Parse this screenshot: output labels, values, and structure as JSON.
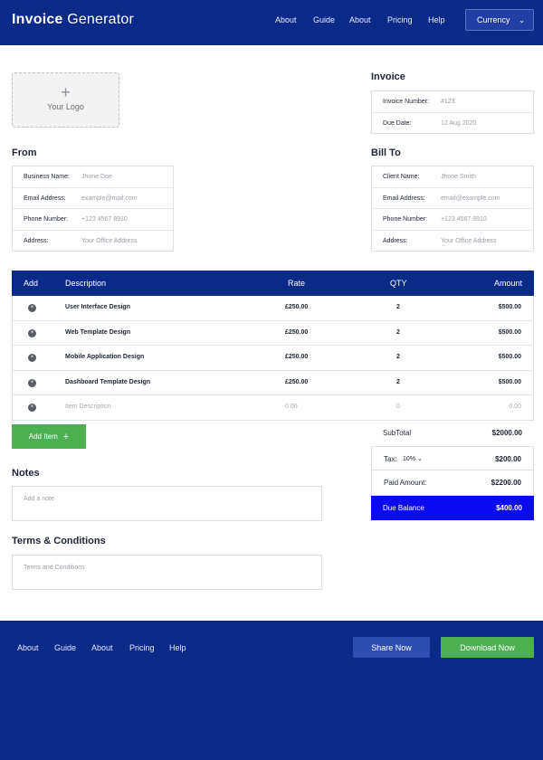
{
  "header": {
    "brand_bold": "Invoice",
    "brand_rest": " Generator",
    "nav": [
      "About",
      "Guide",
      "About",
      "Pricing",
      "Help"
    ],
    "currency_label": "Currency"
  },
  "logo": {
    "label": "Your Logo"
  },
  "invoice": {
    "title": "Invoice",
    "number_label": "Invoice Number:",
    "number_value": "#123",
    "due_label": "Due Date:",
    "due_value": "12 Aug 2020"
  },
  "from": {
    "title": "From",
    "fields": [
      {
        "label": "Business Name:",
        "placeholder": "Jhone Doe"
      },
      {
        "label": "Email Address:",
        "placeholder": "example@mail.com"
      },
      {
        "label": "Phone Number:",
        "placeholder": "+123 4567 8910"
      },
      {
        "label": "Address:",
        "placeholder": "Your Office Address"
      }
    ]
  },
  "bill_to": {
    "title": "Bill To",
    "fields": [
      {
        "label": "Client Name:",
        "placeholder": "Jhone Smith"
      },
      {
        "label": "Email Address:",
        "placeholder": "email@example.com"
      },
      {
        "label": "Phone Number:",
        "placeholder": "+123 4567 8910"
      },
      {
        "label": "Address:",
        "placeholder": "Your Office Address"
      }
    ]
  },
  "table": {
    "headers": {
      "add": "Add",
      "description": "Description",
      "rate": "Rate",
      "qty": "QTY",
      "amount": "Amount"
    },
    "rows": [
      {
        "description": "User Interface Design",
        "rate": "£250.00",
        "qty": "2",
        "amount": "$500.00"
      },
      {
        "description": "Web Template Design",
        "rate": "£250.00",
        "qty": "2",
        "amount": "$500.00"
      },
      {
        "description": "Mobile Application Design",
        "rate": "£250.00",
        "qty": "2",
        "amount": "$500.00"
      },
      {
        "description": "Dashboard Template Design",
        "rate": "£250.00",
        "qty": "2",
        "amount": "$500.00"
      }
    ],
    "empty_row": {
      "description": "Item Description",
      "rate": "0.00",
      "qty": "0",
      "amount": "0.00"
    },
    "remove_glyph": "×"
  },
  "add_item": {
    "label": "Add Item",
    "plus": "+"
  },
  "notes": {
    "title": "Notes",
    "placeholder": "Add a note"
  },
  "terms": {
    "title": "Terms & Conditions",
    "placeholder": "Terms and Conditions"
  },
  "totals": {
    "subtotal_label": "SubTotal",
    "subtotal_value": "$2000.00",
    "tax_label": "Tax:",
    "tax_select": "10%",
    "tax_value": "$200.00",
    "paid_label": "Paid Amount:",
    "paid_value": "$2200.00",
    "due_label": "Due Balance",
    "due_value": "$400.00"
  },
  "footer": {
    "nav": [
      "About",
      "Guide",
      "About",
      "Pricing",
      "Help"
    ],
    "share_label": "Share Now",
    "download_label": "Download Now"
  },
  "colors": {
    "primary": "#0a2a8a",
    "accent_green": "#4caf50",
    "due_blue": "#0a0af0"
  }
}
